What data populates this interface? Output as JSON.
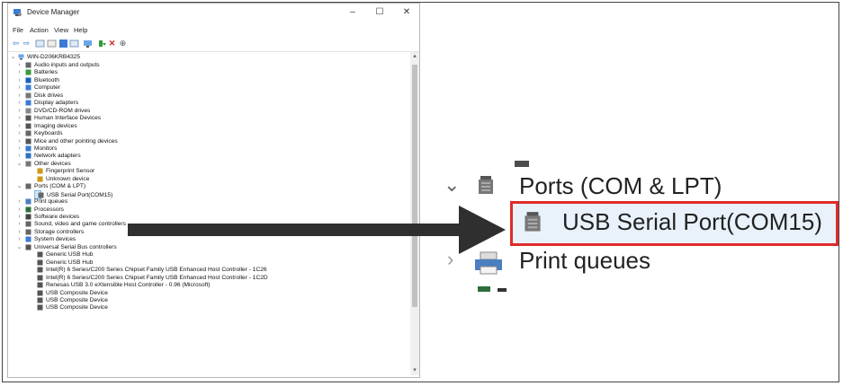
{
  "window": {
    "title": "Device Manager",
    "menu": [
      "File",
      "Action",
      "View",
      "Help"
    ],
    "controls": {
      "minimize": "–",
      "maximize": "☐",
      "close": "✕"
    }
  },
  "tree": {
    "root": "WIN-D206KRB4325",
    "items": [
      {
        "label": "Audio inputs and outputs",
        "level": 1,
        "expander": "collapsed",
        "icon": "speaker-icon"
      },
      {
        "label": "Batteries",
        "level": 1,
        "expander": "collapsed",
        "icon": "battery-icon"
      },
      {
        "label": "Bluetooth",
        "level": 1,
        "expander": "collapsed",
        "icon": "bluetooth-icon"
      },
      {
        "label": "Computer",
        "level": 1,
        "expander": "collapsed",
        "icon": "computer-icon"
      },
      {
        "label": "Disk drives",
        "level": 1,
        "expander": "collapsed",
        "icon": "disk-drive-icon"
      },
      {
        "label": "Display adapters",
        "level": 1,
        "expander": "collapsed",
        "icon": "display-adapter-icon"
      },
      {
        "label": "DVD/CD-ROM drives",
        "level": 1,
        "expander": "collapsed",
        "icon": "dvd-drive-icon"
      },
      {
        "label": "Human Interface Devices",
        "level": 1,
        "expander": "collapsed",
        "icon": "hid-icon"
      },
      {
        "label": "Imaging devices",
        "level": 1,
        "expander": "collapsed",
        "icon": "camera-icon"
      },
      {
        "label": "Keyboards",
        "level": 1,
        "expander": "collapsed",
        "icon": "keyboard-icon"
      },
      {
        "label": "Mice and other pointing devices",
        "level": 1,
        "expander": "collapsed",
        "icon": "mouse-icon"
      },
      {
        "label": "Monitors",
        "level": 1,
        "expander": "collapsed",
        "icon": "monitor-icon"
      },
      {
        "label": "Network adapters",
        "level": 1,
        "expander": "collapsed",
        "icon": "network-icon"
      },
      {
        "label": "Other devices",
        "level": 1,
        "expander": "expanded",
        "icon": "unknown-device-icon"
      },
      {
        "label": "Fingerprint Sensor",
        "level": 2,
        "expander": "",
        "icon": "warning-device-icon"
      },
      {
        "label": "Unknown device",
        "level": 2,
        "expander": "",
        "icon": "warning-device-icon"
      },
      {
        "label": "Ports (COM & LPT)",
        "level": 1,
        "expander": "expanded",
        "icon": "port-icon"
      },
      {
        "label": "USB Serial Port(COM15)",
        "level": 2,
        "expander": "",
        "icon": "port-icon",
        "selected": true
      },
      {
        "label": "Print queues",
        "level": 1,
        "expander": "collapsed",
        "icon": "printer-icon"
      },
      {
        "label": "Processors",
        "level": 1,
        "expander": "collapsed",
        "icon": "processor-icon"
      },
      {
        "label": "Software devices",
        "level": 1,
        "expander": "collapsed",
        "icon": "software-device-icon"
      },
      {
        "label": "Sound, video and game controllers",
        "level": 1,
        "expander": "collapsed",
        "icon": "speaker-icon"
      },
      {
        "label": "Storage controllers",
        "level": 1,
        "expander": "collapsed",
        "icon": "storage-icon"
      },
      {
        "label": "System devices",
        "level": 1,
        "expander": "collapsed",
        "icon": "system-device-icon"
      },
      {
        "label": "Universal Serial Bus controllers",
        "level": 1,
        "expander": "expanded",
        "icon": "usb-icon"
      },
      {
        "label": "Generic USB Hub",
        "level": 2,
        "expander": "",
        "icon": "usb-icon"
      },
      {
        "label": "Generic USB Hub",
        "level": 2,
        "expander": "",
        "icon": "usb-icon"
      },
      {
        "label": "Intel(R) 6 Series/C200 Series Chipset Family USB Enhanced Host Controller - 1C26",
        "level": 2,
        "expander": "",
        "icon": "usb-icon"
      },
      {
        "label": "Intel(R) 6 Series/C200 Series Chipset Family USB Enhanced Host Controller - 1C2D",
        "level": 2,
        "expander": "",
        "icon": "usb-icon"
      },
      {
        "label": "Renesas USB 3.0 eXtensible Host Controller - 0.96 (Microsoft)",
        "level": 2,
        "expander": "",
        "icon": "usb-icon"
      },
      {
        "label": "USB Composite Device",
        "level": 2,
        "expander": "",
        "icon": "usb-icon"
      },
      {
        "label": "USB Composite Device",
        "level": 2,
        "expander": "",
        "icon": "usb-icon"
      },
      {
        "label": "USB Composite Device",
        "level": 2,
        "expander": "",
        "icon": "usb-icon"
      }
    ]
  },
  "zoom": {
    "ports_label": "Ports (COM & LPT)",
    "serial_label": "USB Serial Port(COM15)",
    "print_label": "Print queues"
  },
  "colors": {
    "highlight_border": "#e02a2a",
    "selection_bg": "#cce8ff",
    "arrow": "#2f2f2f"
  }
}
